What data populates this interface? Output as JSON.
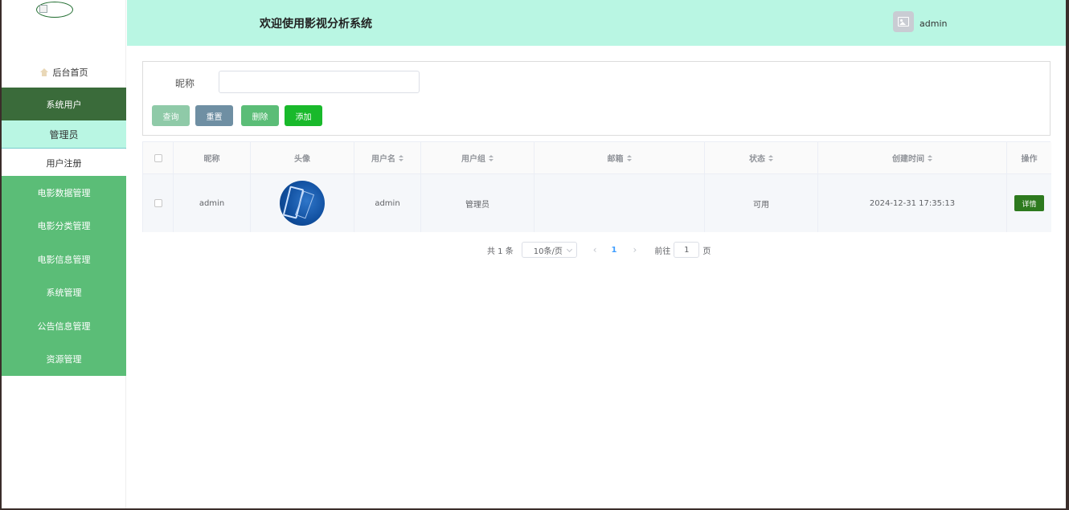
{
  "header": {
    "title": "欢迎使用影视分析系统",
    "username": "admin"
  },
  "sidebar": {
    "home": "后台首页",
    "active_group": "系统用户",
    "sub_active": "管理员",
    "sub_item": "用户注册",
    "items": [
      {
        "label": "电影数据管理"
      },
      {
        "label": "电影分类管理"
      },
      {
        "label": "电影信息管理"
      },
      {
        "label": "系统管理"
      },
      {
        "label": "公告信息管理"
      },
      {
        "label": "资源管理"
      }
    ]
  },
  "search": {
    "label": "昵称",
    "value": "",
    "buttons": {
      "query": "查询",
      "reset": "重置",
      "delete": "删除",
      "add": "添加"
    }
  },
  "table": {
    "headers": [
      "昵称",
      "头像",
      "用户名",
      "用户组",
      "邮箱",
      "状态",
      "创建时间",
      "操作"
    ],
    "rows": [
      {
        "nickname": "admin",
        "username": "admin",
        "group": "管理员",
        "email": "",
        "status": "可用",
        "created": "2024-12-31 17:35:13",
        "action": "详情"
      }
    ]
  },
  "pagination": {
    "total": "共 1 条",
    "page_size": "10条/页",
    "prev": "‹",
    "current": "1",
    "next": "›",
    "goto_label": "前往",
    "goto_value": "1",
    "page_suffix": "页"
  },
  "colors": {
    "header_bg": "#b9f6e3",
    "sidebar_active": "#3a6b3a",
    "sidebar_menu": "#5bbd77",
    "add_button": "#19b92b",
    "detail_button": "#2d7a1e"
  }
}
